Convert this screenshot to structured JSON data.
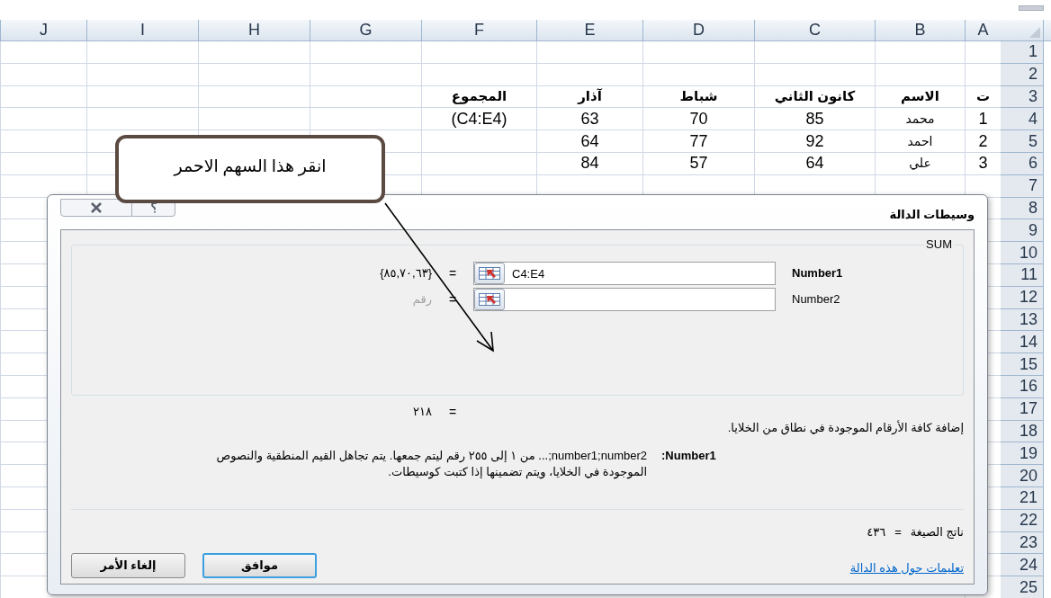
{
  "sheet": {
    "columns": [
      "A",
      "B",
      "C",
      "D",
      "E",
      "F",
      "G",
      "H",
      "I",
      "J"
    ],
    "rows": [
      {
        "number": "1"
      },
      {
        "number": "2"
      },
      {
        "number": "3",
        "heading_cells": [
          "ت",
          "الاسم",
          "كانون الثاني",
          "شباط",
          "آذار",
          "المجموع"
        ]
      },
      {
        "number": "4",
        "cells": [
          "1",
          "محمد",
          "85",
          "70",
          "63",
          "(C4:E4)"
        ]
      },
      {
        "number": "5",
        "cells": [
          "2",
          "احمد",
          "92",
          "77",
          "64"
        ]
      },
      {
        "number": "6",
        "cells": [
          "3",
          "علي",
          "64",
          "57",
          "84"
        ]
      },
      {
        "number": "7"
      },
      {
        "number": "8"
      },
      {
        "number": "9"
      },
      {
        "number": "10"
      },
      {
        "number": "11"
      },
      {
        "number": "12"
      },
      {
        "number": "13"
      },
      {
        "number": "14"
      },
      {
        "number": "15"
      },
      {
        "number": "16"
      },
      {
        "number": "17"
      },
      {
        "number": "18"
      },
      {
        "number": "19"
      },
      {
        "number": "20"
      },
      {
        "number": "21"
      },
      {
        "number": "22"
      },
      {
        "number": "23"
      },
      {
        "number": "24"
      },
      {
        "number": "25"
      }
    ]
  },
  "callout": {
    "text": "انقر هذا السهم الاحمر"
  },
  "dialog": {
    "title": "وسيطات الدالة",
    "function": "SUM",
    "arguments": [
      {
        "name": "Number1",
        "selected": true,
        "value": "C4:E4",
        "equals": "=",
        "result": "{٨٥,٧٠,٦٣}",
        "result_muted": false
      },
      {
        "name": "Number2",
        "selected": false,
        "equals": "=",
        "result": "رقم",
        "result_muted": true
      }
    ],
    "total": {
      "equals": "=",
      "value": "٢١٨"
    },
    "description": "إضافة كافة الأرقام الموجودة في نطاق من الخلايا.",
    "argument_help": {
      "label": "Number1:",
      "text": "number1;number2;... من ١ إلى ٢٥٥ رقم ليتم جمعها. يتم تجاهل القيم المنطقية والنصوص الموجودة في الخلايا، ويتم تضمينها إذا كتبت كوسيطات."
    },
    "formula_result": {
      "label": "ناتج الصيغة",
      "equals": "=",
      "value": "٤٣٦"
    },
    "help_link": "تعليمات حول هذه الدالة",
    "buttons": [
      {
        "label": "موافق",
        "default": true
      },
      {
        "label": "إلغاء الأمر",
        "default": false
      }
    ]
  }
}
